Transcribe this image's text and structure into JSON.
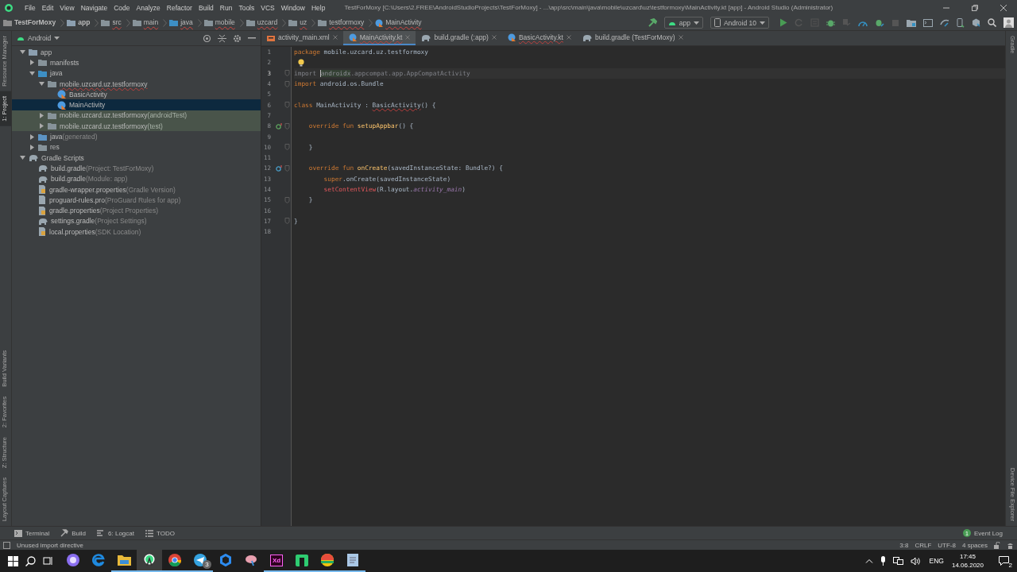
{
  "window": {
    "title": "TestForMoxy [C:\\Users\\2.FREE\\AndroidStudioProjects\\TestForMoxy] - ...\\app\\src\\main\\java\\mobile\\uzcard\\uz\\testformoxy\\MainActivity.kt [app] - Android Studio (Administrator)"
  },
  "menu": [
    "File",
    "Edit",
    "View",
    "Navigate",
    "Code",
    "Analyze",
    "Refactor",
    "Build",
    "Run",
    "Tools",
    "VCS",
    "Window",
    "Help"
  ],
  "breadcrumbs": [
    {
      "label": "TestForMoxy",
      "kind": "project",
      "error": false
    },
    {
      "label": "app",
      "kind": "module",
      "error": false
    },
    {
      "label": "src",
      "kind": "folder",
      "error": true
    },
    {
      "label": "main",
      "kind": "folder",
      "error": true
    },
    {
      "label": "java",
      "kind": "source",
      "error": true
    },
    {
      "label": "mobile",
      "kind": "package",
      "error": true
    },
    {
      "label": "uzcard",
      "kind": "package",
      "error": true
    },
    {
      "label": "uz",
      "kind": "package",
      "error": true
    },
    {
      "label": "testformoxy",
      "kind": "package",
      "error": true
    },
    {
      "label": "MainActivity",
      "kind": "kotlin",
      "error": true
    }
  ],
  "toolbar": {
    "run_config": "app",
    "device": "Android 10"
  },
  "left_strip": {
    "top": [
      {
        "label": "Resource Manager",
        "selected": false
      },
      {
        "label": "1: Project",
        "selected": true
      }
    ],
    "bottom": [
      {
        "label": "Build Variants",
        "selected": false
      },
      {
        "label": "2: Favorites",
        "selected": false
      },
      {
        "label": "Z: Structure",
        "selected": false
      },
      {
        "label": "Layout Captures",
        "selected": false
      }
    ]
  },
  "right_strip": {
    "top": [
      {
        "label": "Gradle"
      }
    ],
    "bottom": [
      {
        "label": "Device File Explorer"
      }
    ]
  },
  "project": {
    "view": "Android",
    "tree": [
      {
        "label": "app",
        "kind": "module",
        "expanded": true,
        "selected": false,
        "tinted": false,
        "children": [
          {
            "label": "manifests",
            "kind": "folder",
            "expanded": false,
            "selected": false,
            "tinted": false
          },
          {
            "label": "java",
            "kind": "source",
            "expanded": true,
            "selected": false,
            "tinted": false,
            "children": [
              {
                "label": "mobile.uzcard.uz.testformoxy",
                "kind": "package",
                "expanded": true,
                "selected": false,
                "tinted": false,
                "error": true,
                "children": [
                  {
                    "label": "BasicActivity",
                    "kind": "kotlin",
                    "selected": false,
                    "tinted": false,
                    "error": false
                  },
                  {
                    "label": "MainActivity",
                    "kind": "kotlin",
                    "selected": true,
                    "tinted": false,
                    "error": false
                  }
                ]
              },
              {
                "label": "mobile.uzcard.uz.testformoxy",
                "note": "(androidTest)",
                "kind": "package",
                "expanded": false,
                "selected": false,
                "tinted": true,
                "error": false
              },
              {
                "label": "mobile.uzcard.uz.testformoxy",
                "note": "(test)",
                "kind": "package",
                "expanded": false,
                "selected": false,
                "tinted": true,
                "error": false
              }
            ]
          },
          {
            "label": "java",
            "note": "(generated)",
            "kind": "generated",
            "expanded": false,
            "selected": false,
            "tinted": false
          },
          {
            "label": "res",
            "kind": "res",
            "expanded": false,
            "selected": false,
            "tinted": false
          }
        ]
      },
      {
        "label": "Gradle Scripts",
        "kind": "gradle",
        "expanded": true,
        "selected": false,
        "tinted": false,
        "children": [
          {
            "label": "build.gradle",
            "note": "(Project: TestForMoxy)",
            "kind": "gradle",
            "selected": false,
            "tinted": false
          },
          {
            "label": "build.gradle",
            "note": "(Module: app)",
            "kind": "gradle",
            "selected": false,
            "tinted": false
          },
          {
            "label": "gradle-wrapper.properties",
            "note": "(Gradle Version)",
            "kind": "properties",
            "selected": false,
            "tinted": false
          },
          {
            "label": "proguard-rules.pro",
            "note": "(ProGuard Rules for app)",
            "kind": "file",
            "selected": false,
            "tinted": false
          },
          {
            "label": "gradle.properties",
            "note": "(Project Properties)",
            "kind": "properties",
            "selected": false,
            "tinted": false
          },
          {
            "label": "settings.gradle",
            "note": "(Project Settings)",
            "kind": "gradle",
            "selected": false,
            "tinted": false
          },
          {
            "label": "local.properties",
            "note": "(SDK Location)",
            "kind": "properties",
            "selected": false,
            "tinted": false
          }
        ]
      }
    ]
  },
  "editor_tabs": [
    {
      "label": "activity_main.xml",
      "kind": "xml",
      "selected": false,
      "error": false
    },
    {
      "label": "MainActivity.kt",
      "kind": "kotlin",
      "selected": true,
      "error": true
    },
    {
      "label": "build.gradle (:app)",
      "kind": "gradle",
      "selected": false,
      "error": false
    },
    {
      "label": "BasicActivity.kt",
      "kind": "kotlin",
      "selected": false,
      "error": true
    },
    {
      "label": "build.gradle (TestForMoxy)",
      "kind": "gradle",
      "selected": false,
      "error": false
    }
  ],
  "code": [
    {
      "number": "1",
      "kind": "code",
      "current": false,
      "fold": false,
      "tokens": [
        {
          "kind": "kw",
          "text": "package"
        },
        {
          "kind": "plain",
          "text": " mobile.uzcard.uz.testformoxy"
        }
      ]
    },
    {
      "number": "2",
      "kind": "bulb",
      "current": false,
      "fold": false
    },
    {
      "number": "3",
      "kind": "code",
      "current": true,
      "fold": true,
      "tokens": [
        {
          "kind": "unused",
          "text": "import "
        },
        {
          "kind": "unused-hl",
          "text": "androidx"
        },
        {
          "kind": "unused",
          "text": ".appcompat.app.AppCompatActivity"
        }
      ]
    },
    {
      "number": "4",
      "kind": "code",
      "current": false,
      "fold": true,
      "tokens": [
        {
          "kind": "kw",
          "text": "import"
        },
        {
          "kind": "plain",
          "text": " android.os.Bundle"
        }
      ]
    },
    {
      "number": "5",
      "kind": "code",
      "current": false,
      "fold": false
    },
    {
      "number": "6",
      "kind": "code",
      "current": false,
      "fold": true,
      "tokens": [
        {
          "kind": "kw",
          "text": "class"
        },
        {
          "kind": "plain",
          "text": " MainActivity : "
        },
        {
          "kind": "wavy",
          "text": "BasicActivity"
        },
        {
          "kind": "plain",
          "text": "() {"
        }
      ]
    },
    {
      "number": "7",
      "kind": "code",
      "current": false,
      "fold": false
    },
    {
      "number": "8",
      "kind": "implements",
      "current": false,
      "fold": true,
      "tokens": [
        {
          "kind": "kw",
          "text": "    override fun "
        },
        {
          "kind": "fn",
          "text": "setupAppbar"
        },
        {
          "kind": "plain",
          "text": "() {"
        }
      ]
    },
    {
      "number": "9",
      "kind": "code",
      "current": false,
      "fold": false
    },
    {
      "number": "10",
      "kind": "code",
      "current": false,
      "fold": true,
      "tokens": [
        {
          "kind": "plain",
          "text": "    }"
        }
      ]
    },
    {
      "number": "11",
      "kind": "code",
      "current": false,
      "fold": false
    },
    {
      "number": "12",
      "kind": "overrides",
      "current": false,
      "fold": true,
      "tokens": [
        {
          "kind": "kw",
          "text": "    override fun "
        },
        {
          "kind": "fn",
          "text": "onCreate"
        },
        {
          "kind": "plain",
          "text": "(savedInstanceState: Bundle?) {"
        }
      ]
    },
    {
      "number": "13",
      "kind": "code",
      "current": false,
      "fold": false,
      "tokens": [
        {
          "kind": "kw",
          "text": "        super"
        },
        {
          "kind": "plain",
          "text": ".onCreate(savedInstanceState)"
        }
      ]
    },
    {
      "number": "14",
      "kind": "code",
      "current": false,
      "fold": false,
      "tokens": [
        {
          "kind": "error",
          "text": "        setContentView"
        },
        {
          "kind": "plain",
          "text": "(R.layout."
        },
        {
          "kind": "field",
          "text": "activity_main"
        },
        {
          "kind": "plain",
          "text": ")"
        }
      ]
    },
    {
      "number": "15",
      "kind": "code",
      "current": false,
      "fold": true,
      "tokens": [
        {
          "kind": "plain",
          "text": "    }"
        }
      ]
    },
    {
      "number": "16",
      "kind": "code",
      "current": false,
      "fold": false
    },
    {
      "number": "17",
      "kind": "code",
      "current": false,
      "fold": true,
      "tokens": [
        {
          "kind": "plain",
          "text": "}"
        }
      ]
    },
    {
      "number": "18",
      "kind": "code",
      "current": false,
      "fold": false
    }
  ],
  "tool_windows": [
    {
      "label": "Terminal",
      "kind": "terminal"
    },
    {
      "label": "Build",
      "kind": "hammer"
    },
    {
      "label": "6: Logcat",
      "kind": "logcat"
    },
    {
      "label": "TODO",
      "kind": "list"
    }
  ],
  "event_log": {
    "label": "Event Log",
    "count": "1"
  },
  "status_bar": {
    "message": "Unused import directive",
    "position": "3:8",
    "line_separator": "CRLF",
    "encoding": "UTF-8",
    "indent": "4 spaces"
  },
  "taskbar": {
    "apps": [
      {
        "kind": "assistant",
        "running": false,
        "active": false
      },
      {
        "kind": "edge",
        "running": false,
        "active": false
      },
      {
        "kind": "folder",
        "running": true,
        "active": false
      },
      {
        "kind": "studio",
        "running": true,
        "active": true
      },
      {
        "kind": "chrome",
        "running": true,
        "active": false
      },
      {
        "kind": "telegram",
        "running": true,
        "active": false,
        "badge": "3"
      },
      {
        "kind": "hex",
        "running": false,
        "active": false
      },
      {
        "kind": "paint",
        "running": false,
        "active": false
      },
      {
        "kind": "xd",
        "label": "Xd",
        "running": true,
        "active": false
      },
      {
        "kind": "green",
        "running": true,
        "active": false
      },
      {
        "kind": "ball",
        "running": true,
        "active": false
      },
      {
        "kind": "notepad",
        "running": true,
        "active": false
      }
    ],
    "language": "ENG",
    "time": "17:45",
    "date": "14.06.2020",
    "notifications": "2"
  }
}
